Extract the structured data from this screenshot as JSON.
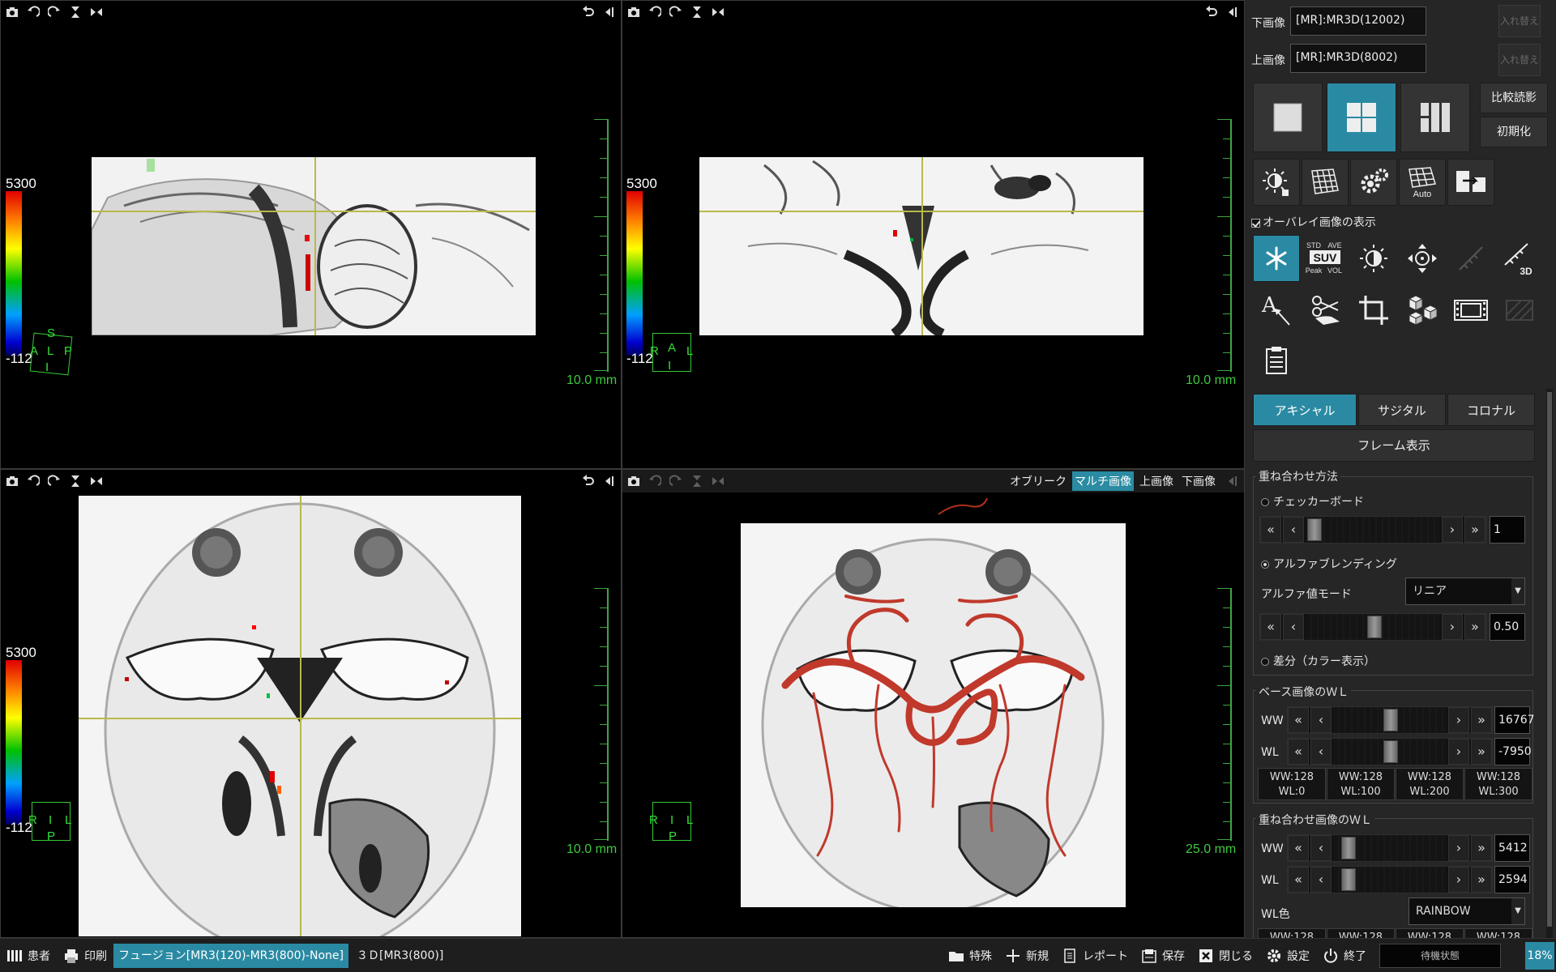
{
  "viewports": {
    "sagittal": {
      "cb_max": "5300",
      "cb_min": "-112",
      "scale": "10.0 mm",
      "orient": {
        "top": "S",
        "left": "A",
        "center": "L",
        "right": "P",
        "bottom": "I"
      }
    },
    "coronal": {
      "cb_max": "5300",
      "cb_min": "-112",
      "scale": "10.0 mm",
      "orient": {
        "left": "R",
        "center": "A",
        "right": "L",
        "bottom": "I"
      }
    },
    "axial": {
      "cb_max": "5300",
      "cb_min": "-112",
      "scale": "10.0 mm",
      "orient": {
        "left": "R",
        "center": "I",
        "right": "L",
        "bottom": "P"
      }
    },
    "volume": {
      "scale": "25.0 mm",
      "orient": {
        "left": "R",
        "center": "I",
        "right": "L",
        "bottom": "P"
      },
      "modes": {
        "oblique": "オブリーク",
        "multi": "マルチ画像",
        "upper": "上画像",
        "lower": "下画像"
      }
    }
  },
  "panel": {
    "lower_image_label": "下画像",
    "lower_image_value": "[MR]:MR3D(12002)",
    "upper_image_label": "上画像",
    "upper_image_value": "[MR]:MR3D(8002)",
    "swap_label": "入れ替え",
    "compare_label": "比較読影",
    "reset_label": "初期化",
    "overlay_label": "オーバレイ画像の表示",
    "tool_suv": {
      "std": "STD",
      "ave": "AVE",
      "suv": "SUV",
      "peak": "Peak",
      "vol": "VOL"
    },
    "tool_auto": "Auto",
    "tool_3d": "3D",
    "tabs": [
      "アキシャル",
      "サジタル",
      "コロナル"
    ],
    "frame_label": "フレーム表示",
    "overlay_method": {
      "title": "重ね合わせ方法",
      "checkerboard": "チェッカーボード",
      "checker_value": "1",
      "alpha_blend": "アルファブレンディング",
      "alpha_mode_label": "アルファ値モード",
      "alpha_mode_value": "リニア",
      "alpha_value": "0.50",
      "diff": "差分（カラー表示）"
    },
    "base_wl": {
      "title": "ベース画像のＷＬ",
      "ww_label": "WW",
      "ww_value": "16767",
      "wl_label": "WL",
      "wl_value": "-7950",
      "presets": [
        {
          "ww": "WW:128",
          "wl": "WL:0"
        },
        {
          "ww": "WW:128",
          "wl": "WL:100"
        },
        {
          "ww": "WW:128",
          "wl": "WL:200"
        },
        {
          "ww": "WW:128",
          "wl": "WL:300"
        }
      ]
    },
    "overlay_wl": {
      "title": "重ね合わせ画像のＷＬ",
      "ww_label": "WW",
      "ww_value": "5412",
      "wl_label": "WL",
      "wl_value": "2594",
      "color_label": "WL色",
      "color_value": "RAINBOW",
      "presets_partial": [
        "WW:128",
        "WW:128",
        "WW:128",
        "WW:128"
      ]
    }
  },
  "bottom_bar": {
    "patient": "患者",
    "print": "印刷",
    "tab_fusion": "フュージョン[MR3(120)-MR3(800)-None]",
    "tab_3d": "３Ｄ[MR3(800)]",
    "special": "特殊",
    "new": "新規",
    "report": "レポート",
    "save": "保存",
    "close": "閉じる",
    "settings": "設定",
    "exit": "終了",
    "status": "待機状態",
    "percent": "18%"
  },
  "colors": {
    "accent": "#2b8aa3",
    "crosshair": "#b9b94a",
    "scale_green": "#3fc73f",
    "vessel": "#c0392b"
  }
}
